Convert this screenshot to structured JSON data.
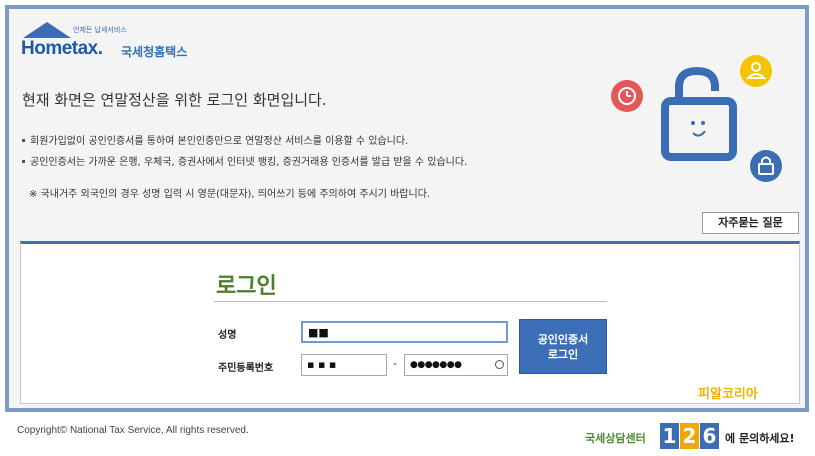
{
  "header": {
    "logo_tagline": "언제든 납세서비스",
    "logo_brand": "Hometax.",
    "logo_korean": "국세청홈택스"
  },
  "main": {
    "headline": "현재 화면은 연말정산을 위한 로그인 화면입니다.",
    "bullets": [
      "회원가입없이 공인인증서를 통하여 본인인증만으로 연말정산 서비스를 이용할 수 있습니다.",
      "공인인증서는 가까운 은행, 우체국, 증권사에서 인터넷 뱅킹, 증권거래용 인증서를 발급 받을 수 있습니다."
    ],
    "note": "※ 국내거주 외국인의 경우 성명 입력 시 영문(대문자), 띄어쓰기 등에 주의하여 주시기 바랍니다.",
    "faq_label": "자주묻는 질문"
  },
  "login": {
    "title": "로그인",
    "name_label": "성명",
    "name_value": "■■",
    "rrn_label": "주민등록번호",
    "rrn_front_value": "▪ ▪  ▪",
    "rrn_separator": "-",
    "rrn_back_value": "●●●●●●●",
    "cert_button_line1": "공인인증서",
    "cert_button_line2": "로그인",
    "watermark": "피알코리아"
  },
  "footer": {
    "copyright": "Copyright© National Tax Service,  All rights reserved.",
    "call_prefix": "국세상담센터",
    "call_digits": [
      "1",
      "2",
      "6"
    ],
    "call_suffix": "에 문의하세요!"
  },
  "colors": {
    "frame_border": "#7d9bc4",
    "accent_blue": "#3c6fb7",
    "login_green": "#4a7e2a",
    "watermark_yellow": "#f0b400",
    "badge_red": "#e25757",
    "badge_yellow": "#f5c400",
    "badge_blue": "#3a6db3"
  },
  "icons": [
    "home-logo-icon",
    "clock-icon",
    "user-icon",
    "padlock-illustration",
    "lock-icon",
    "eye-icon"
  ]
}
